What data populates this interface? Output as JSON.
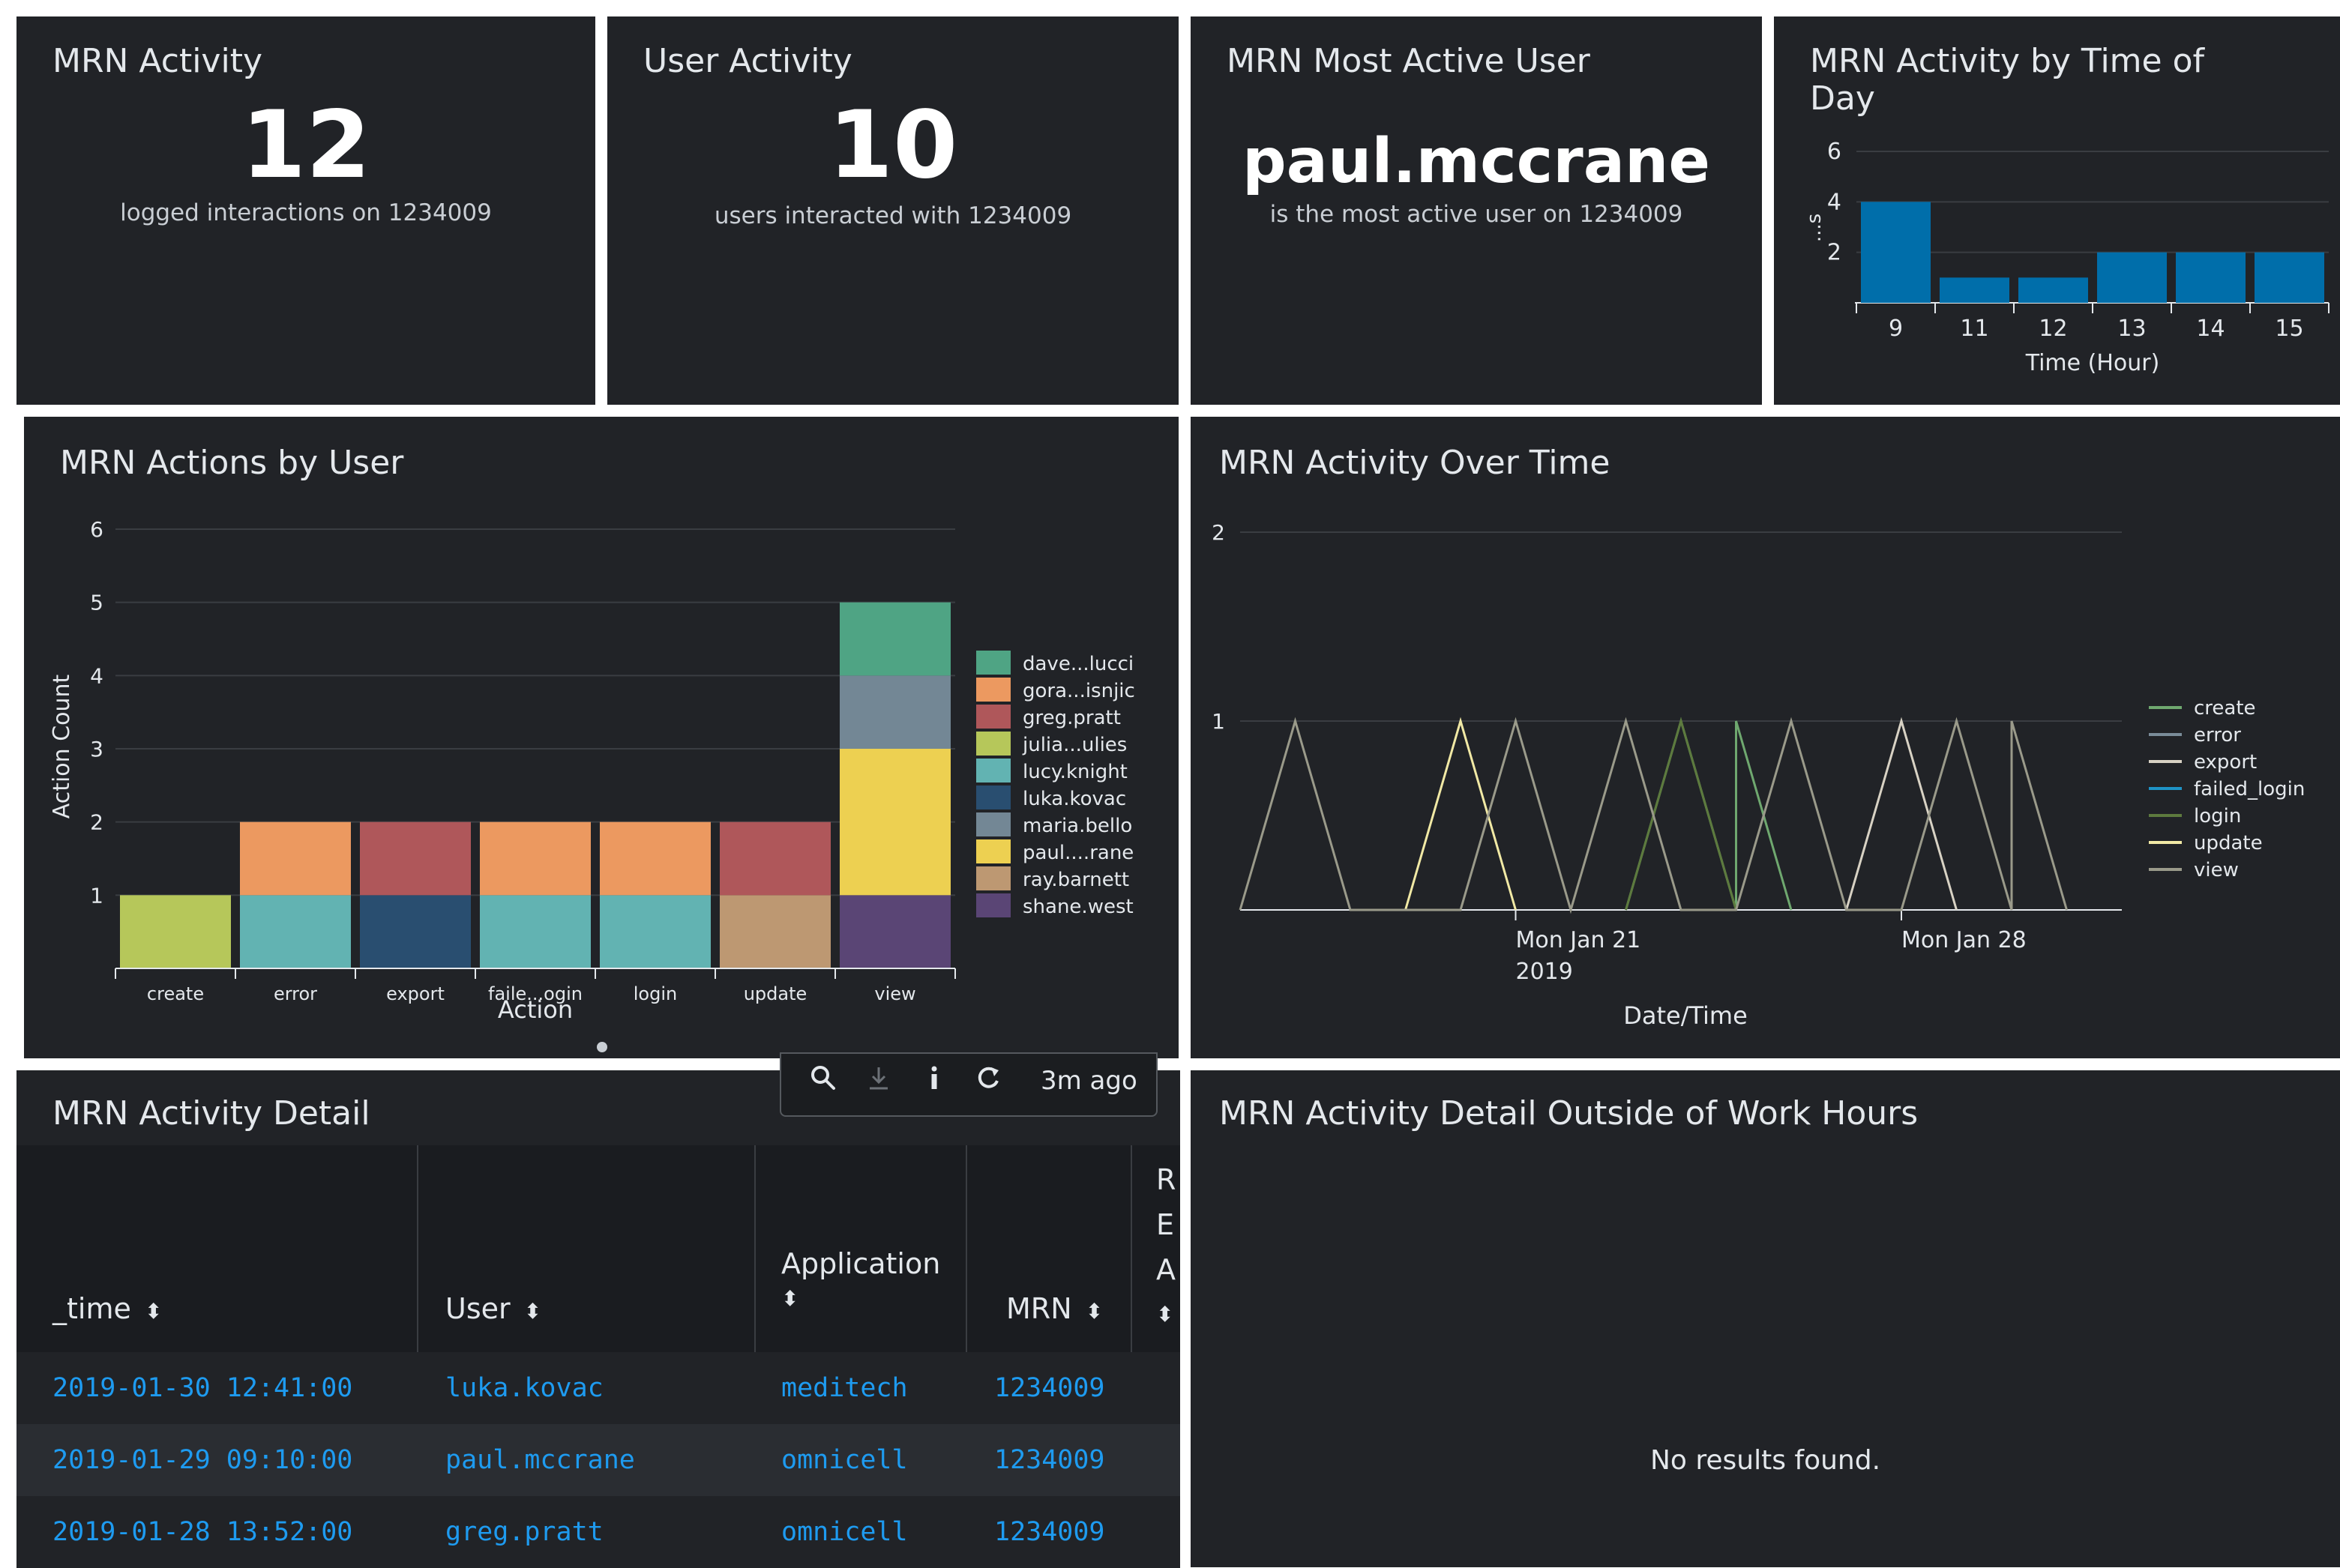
{
  "panels": {
    "mrn_activity": {
      "title": "MRN Activity",
      "value": "12",
      "subtitle": "logged interactions on 1234009"
    },
    "user_activity": {
      "title": "User Activity",
      "value": "10",
      "subtitle": "users interacted with 1234009"
    },
    "most_active": {
      "title": "MRN Most Active User",
      "value": "paul.mccrane",
      "subtitle": "is the most active user on 1234009"
    },
    "time_of_day": {
      "title_line1": "MRN Activity by Time of",
      "title_line2": "Day"
    },
    "actions_by_user": {
      "title": "MRN Actions by User"
    },
    "over_time": {
      "title": "MRN Activity Over Time"
    },
    "detail": {
      "title": "MRN Activity Detail"
    },
    "outside_hours": {
      "title": "MRN Activity Detail Outside of Work Hours",
      "empty_message": "No results found."
    }
  },
  "toolbar": {
    "refresh_text": "3m ago"
  },
  "table": {
    "headers": {
      "time": "_time",
      "user": "User",
      "application": "Application",
      "mrn": "MRN",
      "clipped_letters": [
        "R",
        "E",
        "A"
      ]
    },
    "rows": [
      {
        "time": "2019-01-30 12:41:00",
        "user": "luka.kovac",
        "application": "meditech",
        "mrn": "1234009"
      },
      {
        "time": "2019-01-29 09:10:00",
        "user": "paul.mccrane",
        "application": "omnicell",
        "mrn": "1234009"
      },
      {
        "time": "2019-01-28 13:52:00",
        "user": "greg.pratt",
        "application": "omnicell",
        "mrn": "1234009"
      }
    ]
  },
  "colors": {
    "panel_bg": "#212327",
    "link": "#1e9bf0",
    "bar_blue": "#006eaa"
  },
  "chart_data": [
    {
      "id": "time_of_day",
      "type": "bar",
      "categories": [
        "9",
        "11",
        "12",
        "13",
        "14",
        "15"
      ],
      "values": [
        4,
        1,
        1,
        2,
        2,
        2
      ],
      "xlabel": "Time (Hour)",
      "ylabel": "...s",
      "yticks": [
        2,
        4,
        6
      ],
      "ylim": [
        0,
        6
      ],
      "color": "#006eaa"
    },
    {
      "id": "actions_by_user",
      "type": "bar",
      "stacked": true,
      "categories": [
        "create",
        "error",
        "export",
        "faile...ogin",
        "login",
        "update",
        "view"
      ],
      "xlabel": "Action",
      "ylabel": "Action Count",
      "yticks": [
        1,
        2,
        3,
        4,
        5,
        6
      ],
      "ylim": [
        0,
        6
      ],
      "legend_position": "right",
      "series": [
        {
          "name": "dave...lucci",
          "color": "#4fa484",
          "values": [
            0,
            0,
            0,
            0,
            0,
            0,
            1
          ]
        },
        {
          "name": "gora...isnjic",
          "color": "#ec9960",
          "values": [
            0,
            1,
            0,
            1,
            1,
            0,
            0
          ]
        },
        {
          "name": "greg.pratt",
          "color": "#af575a",
          "values": [
            0,
            0,
            1,
            0,
            0,
            1,
            0
          ]
        },
        {
          "name": "julia...ulies",
          "color": "#b6c75a",
          "values": [
            1,
            0,
            0,
            0,
            0,
            0,
            0
          ]
        },
        {
          "name": "lucy.knight",
          "color": "#62b3b2",
          "values": [
            0,
            1,
            0,
            1,
            1,
            0,
            0
          ]
        },
        {
          "name": "luka.kovac",
          "color": "#294e70",
          "values": [
            0,
            0,
            1,
            0,
            0,
            0,
            0
          ]
        },
        {
          "name": "maria.bello",
          "color": "#738795",
          "values": [
            0,
            0,
            0,
            0,
            0,
            0,
            1
          ]
        },
        {
          "name": "paul....rane",
          "color": "#edd051",
          "values": [
            0,
            0,
            0,
            0,
            0,
            0,
            2
          ]
        },
        {
          "name": "ray.barnett",
          "color": "#bd9872",
          "values": [
            0,
            0,
            0,
            0,
            0,
            1,
            0
          ]
        },
        {
          "name": "shane.west",
          "color": "#5a4575",
          "values": [
            0,
            0,
            0,
            0,
            0,
            0,
            1
          ]
        }
      ]
    },
    {
      "id": "over_time",
      "type": "line",
      "xlabel": "Date/Time",
      "xtick_labels": [
        {
          "date": "2019-01-21",
          "line1": "Mon Jan 21",
          "line2": "2019"
        },
        {
          "date": "2019-01-28",
          "line1": "Mon Jan 28",
          "line2": ""
        }
      ],
      "x_range": [
        "2019-01-16",
        "2019-02-01"
      ],
      "yticks": [
        1,
        2
      ],
      "ylim": [
        0,
        2
      ],
      "legend_position": "right",
      "series": [
        {
          "name": "create",
          "color": "#6fa86f",
          "peaks": [
            "2019-01-24",
            "2019-01-25"
          ]
        },
        {
          "name": "error",
          "color": "#7a8c99",
          "peaks": []
        },
        {
          "name": "export",
          "color": "#d8d2c4",
          "peaks": [
            "2019-01-28"
          ]
        },
        {
          "name": "failed_login",
          "color": "#1e93c6",
          "peaks": []
        },
        {
          "name": "login",
          "color": "#5d7a3e",
          "peaks": [
            "2019-01-24"
          ]
        },
        {
          "name": "update",
          "color": "#f1e9a5",
          "peaks": [
            "2019-01-20"
          ]
        },
        {
          "name": "view",
          "color": "#9a9a8a",
          "peaks": [
            "2019-01-17",
            "2019-01-21",
            "2019-01-23",
            "2019-01-26",
            "2019-01-29",
            "2019-01-30"
          ]
        }
      ]
    }
  ]
}
